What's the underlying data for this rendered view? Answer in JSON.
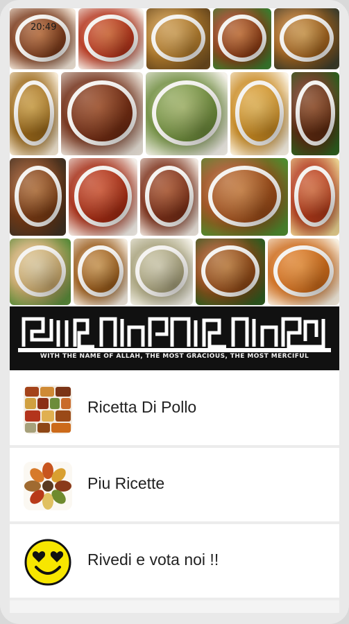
{
  "status_bar": {
    "time": "20:49"
  },
  "collage": {
    "tiles": [
      {
        "name": "dish-1",
        "colors": [
          "#7a3a1b",
          "#c06a33",
          "#f2e6d8"
        ]
      },
      {
        "name": "dish-2",
        "colors": [
          "#b3341c",
          "#d8622a",
          "#f5f1ea"
        ]
      },
      {
        "name": "dish-3",
        "colors": [
          "#b17b2c",
          "#d6a14e",
          "#6b4a1e"
        ]
      },
      {
        "name": "dish-4",
        "colors": [
          "#8a3b15",
          "#c96b2b",
          "#3b7a2e"
        ]
      },
      {
        "name": "dish-5",
        "colors": [
          "#a0611d",
          "#d49a45",
          "#3c3c2a"
        ]
      },
      {
        "name": "dish-6",
        "colors": [
          "#9d6a1b",
          "#d4a23d",
          "#f6ead5"
        ]
      },
      {
        "name": "dish-7",
        "colors": [
          "#6e2a12",
          "#a2481d",
          "#e9e2d8"
        ]
      },
      {
        "name": "dish-8",
        "colors": [
          "#6c8a3b",
          "#a7bb67",
          "#f4f1ea"
        ]
      },
      {
        "name": "dish-9",
        "colors": [
          "#c98a22",
          "#e9b54b",
          "#fbf4e6"
        ]
      },
      {
        "name": "dish-10",
        "colors": [
          "#5e2a10",
          "#8d4219",
          "#2e5e1e"
        ]
      },
      {
        "name": "dish-11",
        "colors": [
          "#7a3b14",
          "#b46a2e",
          "#3f3022"
        ]
      },
      {
        "name": "dish-12",
        "colors": [
          "#a32a12",
          "#d8502a",
          "#f3efe9"
        ]
      },
      {
        "name": "dish-13",
        "colors": [
          "#7b2f18",
          "#b05025",
          "#f0e8e0"
        ]
      },
      {
        "name": "dish-14",
        "colors": [
          "#9a4a18",
          "#cf7b35",
          "#4f8a2e"
        ]
      },
      {
        "name": "dish-15",
        "colors": [
          "#b33a1a",
          "#d96836",
          "#e8d090"
        ]
      },
      {
        "name": "dish-16",
        "colors": [
          "#c9a86b",
          "#e3d0a2",
          "#5a8a3a"
        ]
      },
      {
        "name": "dish-17",
        "colors": [
          "#9a5c1c",
          "#d39a4d",
          "#f4ece0"
        ]
      },
      {
        "name": "dish-18",
        "colors": [
          "#a6a07a",
          "#d7d2b3",
          "#f2f0e6"
        ]
      },
      {
        "name": "dish-19",
        "colors": [
          "#8e4716",
          "#c37a33",
          "#2f5a1f"
        ]
      },
      {
        "name": "dish-20",
        "colors": [
          "#cc6a1a",
          "#f08e2f",
          "#f7efe0"
        ]
      }
    ]
  },
  "banner": {
    "caption": "WITH THE NAME OF ALLAH, THE MOST GRACIOUS, THE MOST MERCIFUL"
  },
  "menu": {
    "items": [
      {
        "label": "Ricetta Di Pollo",
        "icon": "recipe-collage-icon"
      },
      {
        "label": "Piu Ricette",
        "icon": "spices-icon"
      },
      {
        "label": "Rivedi e vota noi !!",
        "icon": "heart-eyes-smiley-icon"
      }
    ]
  },
  "colors": {
    "background": "#e9e9e9",
    "menu_bg": "#ffffff",
    "banner_bg": "#111111",
    "smiley_yellow": "#f7e600"
  }
}
